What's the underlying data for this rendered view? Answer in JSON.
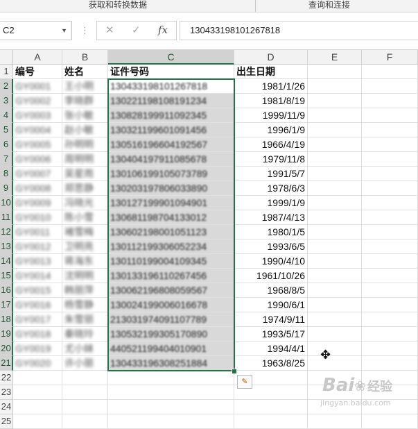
{
  "ribbon": {
    "group1": "获取和转换数据",
    "group2": "查询和连接"
  },
  "formula_bar": {
    "name_box": "C2",
    "cancel_icon": "✕",
    "enter_icon": "✓",
    "fx_label": "fx",
    "value": "130433198101267818"
  },
  "columns": [
    "A",
    "B",
    "C",
    "D",
    "E",
    "F"
  ],
  "rows": [
    "1",
    "2",
    "3",
    "4",
    "5",
    "6",
    "7",
    "8",
    "9",
    "10",
    "11",
    "12",
    "13",
    "14",
    "15",
    "16",
    "17",
    "18",
    "19",
    "20",
    "21",
    "22",
    "23",
    "24",
    "25"
  ],
  "headers": {
    "a": "编号",
    "b": "姓名",
    "c": "证件号码",
    "d": "出生日期"
  },
  "data_rows": [
    {
      "a": "GY0001",
      "b": "王小明",
      "c": "130433198101267818",
      "d": "1981/1/26"
    },
    {
      "a": "GY0002",
      "b": "李晓群",
      "c": "130221198108191234",
      "d": "1981/8/19"
    },
    {
      "a": "GY0003",
      "b": "张小敏",
      "c": "130828199911092345",
      "d": "1999/11/9"
    },
    {
      "a": "GY0004",
      "b": "赵小敏",
      "c": "130321199601091456",
      "d": "1996/1/9"
    },
    {
      "a": "GY0005",
      "b": "孙明明",
      "c": "130516196604192567",
      "d": "1966/4/19"
    },
    {
      "a": "GY0006",
      "b": "周明明",
      "c": "130404197911085678",
      "d": "1979/11/8"
    },
    {
      "a": "GY0007",
      "b": "吴星雨",
      "c": "130106199105073789",
      "d": "1991/5/7"
    },
    {
      "a": "GY0008",
      "b": "郑思静",
      "c": "130203197806033890",
      "d": "1978/6/3"
    },
    {
      "a": "GY0009",
      "b": "冯晓光",
      "c": "130127199901094901",
      "d": "1999/1/9"
    },
    {
      "a": "GY0010",
      "b": "陈小雪",
      "c": "130681198704133012",
      "d": "1987/4/13"
    },
    {
      "a": "GY0011",
      "b": "褚雪梅",
      "c": "130602198001051123",
      "d": "1980/1/5"
    },
    {
      "a": "GY0012",
      "b": "卫明亮",
      "c": "130112199306052234",
      "d": "1993/6/5"
    },
    {
      "a": "GY0013",
      "b": "蒋海东",
      "c": "130110199004109345",
      "d": "1990/4/10"
    },
    {
      "a": "GY0014",
      "b": "沈明明",
      "c": "130133196110267456",
      "d": "1961/10/26"
    },
    {
      "a": "GY0015",
      "b": "韩丽萍",
      "c": "130062196808059567",
      "d": "1968/8/5"
    },
    {
      "a": "GY0016",
      "b": "杨雪静",
      "c": "130024199006016678",
      "d": "1990/6/1"
    },
    {
      "a": "GY0017",
      "b": "朱雪丽",
      "c": "213031974091107789",
      "d": "1974/9/11"
    },
    {
      "a": "GY0018",
      "b": "秦晓玲",
      "c": "130532199305170890",
      "d": "1993/5/17"
    },
    {
      "a": "GY0019",
      "b": "尤小妹",
      "c": "440521199404010901",
      "d": "1994/4/1"
    },
    {
      "a": "GY0020",
      "b": "许小丽",
      "c": "130433196308251884",
      "d": "1963/8/25"
    }
  ],
  "quick_analysis_icon": "quick-analysis-icon",
  "cursor_icon": "move-cursor-icon",
  "watermark": {
    "brand": "Bai",
    "paw": "du",
    "label": "经验",
    "url": "jingyan.baidu.com"
  },
  "colors": {
    "accent_green": "#217346",
    "selected_header": "#d2d2d2",
    "selection_fill": "#d9d9d9"
  }
}
